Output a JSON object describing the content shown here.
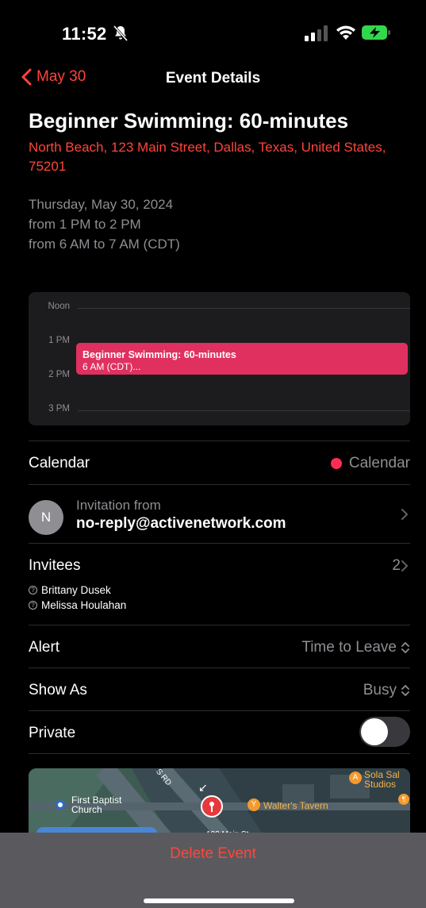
{
  "status_bar": {
    "time": "11:52"
  },
  "nav": {
    "back_label": "May 30",
    "title": "Event Details"
  },
  "event": {
    "title": "Beginner Swimming: 60-minutes",
    "location": "North Beach, 123 Main Street, Dallas, Texas, United States, 75201",
    "date": "Thursday, May 30, 2024",
    "time_local": "from 1 PM to 2 PM",
    "time_original": "from 6 AM to 7 AM (CDT)"
  },
  "day_view": {
    "hours": [
      "Noon",
      "1 PM",
      "2 PM",
      "3 PM"
    ],
    "event_title": "Beginner Swimming: 60-minutes",
    "event_subtitle": "6 AM (CDT)..."
  },
  "calendar_row": {
    "label": "Calendar",
    "value": "Calendar",
    "color": "#ff2d55"
  },
  "invitation": {
    "avatar_initial": "N",
    "label": "Invitation from",
    "email": "no-reply@activenetwork.com"
  },
  "invitees": {
    "label": "Invitees",
    "count": "2",
    "names": [
      "Brittany Dusek",
      "Melissa Houlahan"
    ]
  },
  "alert": {
    "label": "Alert",
    "value": "Time to Leave"
  },
  "show_as": {
    "label": "Show As",
    "value": "Busy"
  },
  "private": {
    "label": "Private",
    "on": false
  },
  "map": {
    "labels": {
      "church": "First Baptist Church",
      "church_line1": "First Baptist",
      "church_line2": "Church",
      "tavern": "Walter's Tavern",
      "road": "S RD",
      "studio": "Sola Sal Studios",
      "studio_line1": "Sola Sal",
      "studio_line2": "Studios",
      "street": "123 Main St"
    }
  },
  "actions": {
    "delete_label": "Delete Event"
  },
  "colors": {
    "accent": "#ff453a",
    "event": "#e0305f",
    "background": "#000000"
  }
}
